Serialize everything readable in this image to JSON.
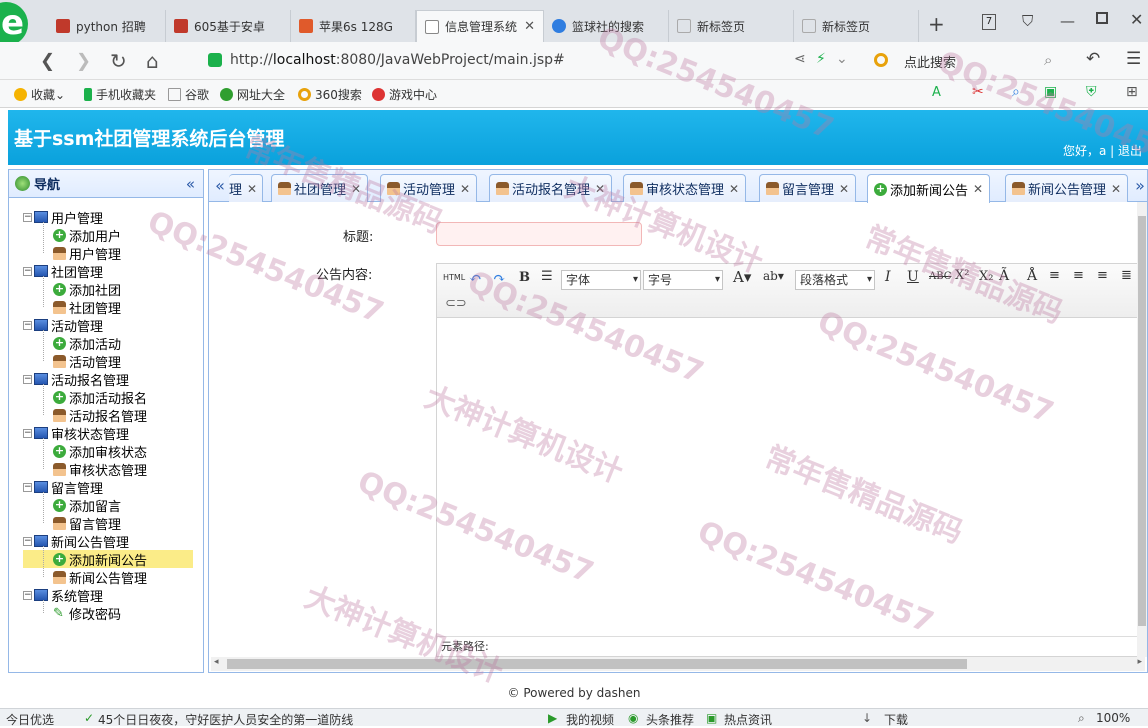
{
  "browser": {
    "tabs": [
      {
        "title": "python 招聘",
        "color": "#c0392b"
      },
      {
        "title": "605基于安卓",
        "color": "#c0392b"
      },
      {
        "title": "苹果6s 128G",
        "color": "#e05a2b"
      },
      {
        "title": "信息管理系统",
        "color": "#888888",
        "active": true
      },
      {
        "title": "篮球社的搜索",
        "color": "#2f7de0"
      },
      {
        "title": "新标签页",
        "color": "#aaaaaa"
      },
      {
        "title": "新标签页",
        "color": "#aaaaaa"
      }
    ],
    "new_tab": "+",
    "tab_count": "7",
    "address_prefix": "http://",
    "address_host": "localhost",
    "address_rest": ":8080/JavaWebProject/main.jsp#",
    "search_placeholder": "点此搜索",
    "bookmarks": [
      "收藏",
      "手机收藏夹",
      "谷歌",
      "网址大全",
      "360搜索",
      "游戏中心"
    ]
  },
  "app": {
    "title": "基于ssm社团管理系统后台管理",
    "welcome": "您好，a | 退出",
    "nav_title": "导航",
    "collapse": "«"
  },
  "tree": [
    {
      "label": "用户管理",
      "children": [
        "添加用户",
        "用户管理"
      ]
    },
    {
      "label": "社团管理",
      "children": [
        "添加社团",
        "社团管理"
      ]
    },
    {
      "label": "活动管理",
      "children": [
        "添加活动",
        "活动管理"
      ]
    },
    {
      "label": "活动报名管理",
      "children": [
        "添加活动报名",
        "活动报名管理"
      ]
    },
    {
      "label": "审核状态管理",
      "children": [
        "添加审核状态",
        "审核状态管理"
      ]
    },
    {
      "label": "留言管理",
      "children": [
        "添加留言",
        "留言管理"
      ]
    },
    {
      "label": "新闻公告管理",
      "children": [
        "添加新闻公告",
        "新闻公告管理"
      ]
    },
    {
      "label": "系统管理",
      "children": [
        "修改密码"
      ]
    }
  ],
  "content_tabs": [
    "理",
    "社团管理",
    "活动管理",
    "活动报名管理",
    "审核状态管理",
    "留言管理",
    "添加新闻公告",
    "新闻公告管理"
  ],
  "form": {
    "title_label": "标题:",
    "title_value": "",
    "content_label": "公告内容:",
    "font_family": "字体",
    "font_size": "字号",
    "paragraph": "段落格式",
    "element_path": "元素路径:"
  },
  "footer": "© Powered by dashen",
  "statusbar": {
    "left": "今日优选",
    "news": "45个日日夜夜，守好医护人员安全的第一道防线",
    "video": "我的视频",
    "headline": "头条推荐",
    "hot": "热点资讯",
    "download": "下载",
    "zoom": "100%"
  },
  "watermarks": [
    "QQ:254540457",
    "大神计算机设计",
    "常年售精品源码"
  ]
}
